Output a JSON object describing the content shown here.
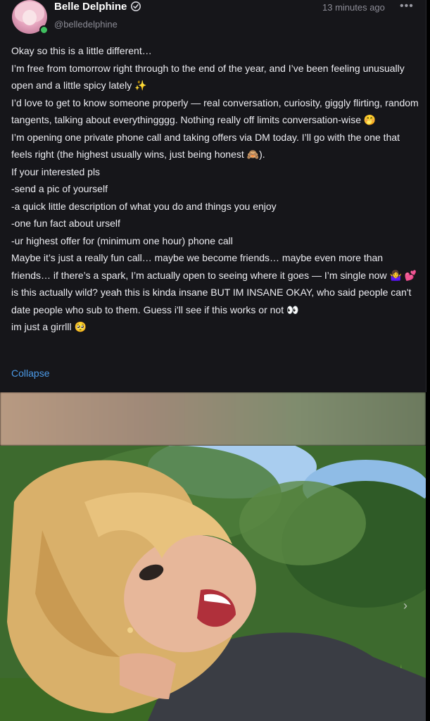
{
  "post": {
    "author": "Belle Delphine",
    "handle": "@belledelphine",
    "timestamp": "13 minutes ago",
    "more_label": "•••",
    "body": "Okay so this is a little different…\nI’m free from tomorrow right through to the end of the year, and I’ve been feeling unusually open and a little spicy lately ✨\nI’d love to get to know someone properly — real conversation, curiosity, giggly flirting, random tangents, talking about everythingggg. Nothing really off limits conversation-wise 🤭\nI’m opening one private phone call and taking offers via DM today. I’ll go with the one that feels right (the highest usually wins, just being honest 🙈).\nIf your interested pls\n-send a pic of yourself\n-a quick little description of what you do and things you enjoy\n-one fun fact about urself\n-ur highest offer for (minimum one hour) phone call\nMaybe it’s just a really fun call… maybe we become friends… maybe even more than friends… if there’s a spark, I’m actually open to seeing where it goes — I’m single now 🤷‍♀️ 💕\nis this actually wild? yeah this is kinda insane BUT IM INSANE OKAY, who said people can't date people who sub to them. Guess i'll see if this works or not 👀\nim just a girrlll 🥺",
    "collapse_label": "Collapse"
  },
  "colors": {
    "background": "#16161a",
    "text": "#ececf1",
    "muted": "#8c8c96",
    "link": "#4c9be8",
    "online": "#3fbf5f"
  },
  "icons": {
    "verified": "verified-badge-icon",
    "more": "more-options-icon",
    "next": "chevron-right-icon"
  }
}
